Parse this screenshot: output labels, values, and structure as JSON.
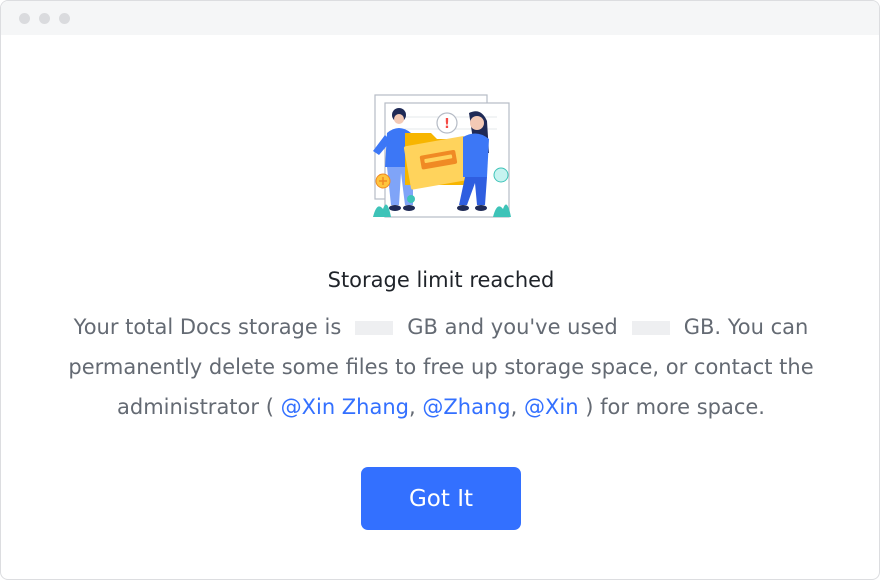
{
  "dialog": {
    "title": "Storage limit reached",
    "body": {
      "part1": "Your total Docs storage is",
      "part2": "GB and you've used",
      "part3": "GB. You can permanently delete some files to free up storage space, or contact the administrator (",
      "mentions": [
        "@Xin Zhang",
        "@Zhang",
        "@Xin"
      ],
      "separator": ",",
      "part4": ") for more space."
    },
    "button_label": "Got It"
  },
  "illustration": {
    "alert_symbol": "!",
    "icon": "storage-full-illustration"
  },
  "colors": {
    "accent": "#3370ff",
    "text_primary": "#1f2329",
    "text_secondary": "#646a73",
    "redaction": "#eeeff1"
  }
}
